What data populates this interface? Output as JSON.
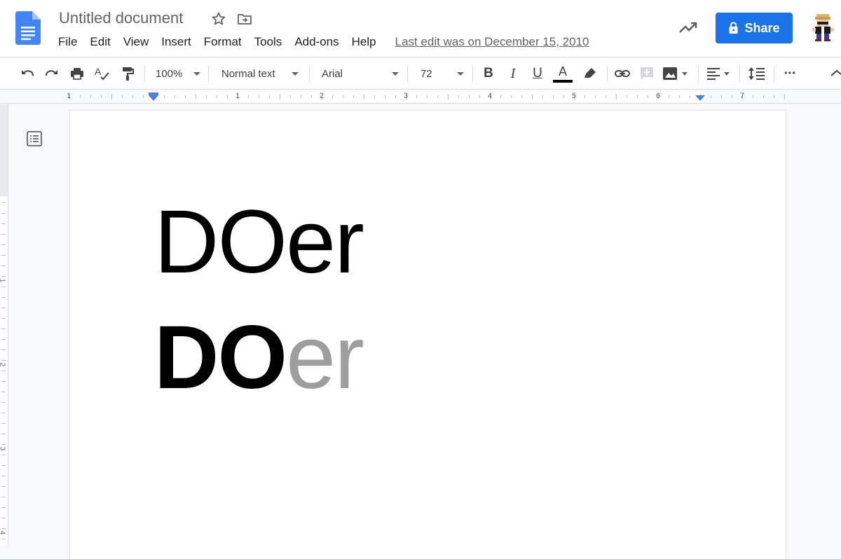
{
  "app": {
    "title": "Untitled document",
    "menu": [
      "File",
      "Edit",
      "View",
      "Insert",
      "Format",
      "Tools",
      "Add-ons",
      "Help"
    ],
    "last_edit": "Last edit was on December 15, 2010",
    "share_label": "Share",
    "colors": {
      "share": "#1a73e8",
      "docs_blue": "#4285f4",
      "ruler_marker": "#4a7fe0"
    }
  },
  "toolbar": {
    "zoom": "100%",
    "style": "Normal text",
    "font": "Arial",
    "size": "72",
    "bold": "B",
    "italic": "I",
    "underline": "U",
    "text_color": "A",
    "more": "···",
    "icons": [
      "undo-icon",
      "redo-icon",
      "print-icon",
      "spellcheck-icon",
      "paint-format-icon",
      "highlighter-icon",
      "link-icon",
      "add-comment-icon",
      "insert-image-icon",
      "align-left-icon",
      "line-spacing-icon",
      "more-icon",
      "collapse-icon"
    ]
  },
  "ruler": {
    "numbers": [
      "1",
      "1",
      "2",
      "3",
      "4",
      "5",
      "6",
      "7"
    ],
    "vertical_numbers": [
      "1",
      "2",
      "3",
      "4"
    ]
  },
  "document": {
    "line1": "DOer",
    "line2_bold": "DO",
    "line2_gray": "er"
  }
}
